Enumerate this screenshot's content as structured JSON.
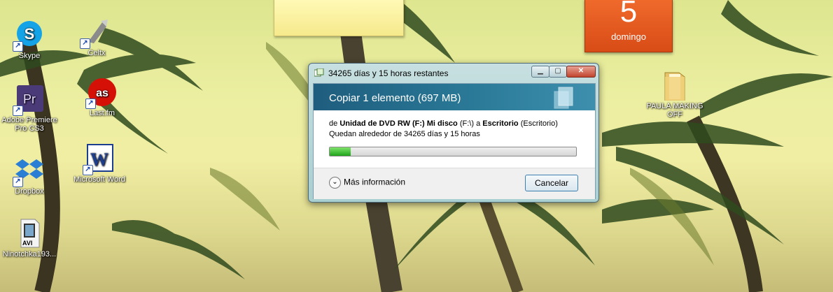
{
  "desktop_icons": [
    {
      "label": "Skype",
      "icon": "skype-icon"
    },
    {
      "label": "Celtx",
      "icon": "celtx-icon"
    },
    {
      "label": "Adobe Premiere Pro CS3",
      "icon": "premiere-icon"
    },
    {
      "label": "Last.fm",
      "icon": "lastfm-icon"
    },
    {
      "label": "Dropbox",
      "icon": "dropbox-icon"
    },
    {
      "label": "Microsoft Word",
      "icon": "word-icon"
    },
    {
      "label": "Ninotchka193...",
      "icon": "avi-file-icon",
      "badge": "AVI"
    },
    {
      "label": "PAULA MAKING OFF",
      "icon": "folder-icon"
    }
  ],
  "calendar": {
    "day": "5",
    "weekday": "domingo"
  },
  "dialog": {
    "title": "34265 días y 15 horas restantes",
    "header": "Copiar 1 elemento (697 MB)",
    "from_prefix": "de",
    "source": "Unidad de DVD RW (F:) Mi disco",
    "source_path": "(F:\\)",
    "to_word": "a",
    "destination": "Escritorio",
    "destination_paren": "(Escritorio)",
    "remaining": "Quedan alrededor de 34265 días y 15 horas",
    "progress": 0.085,
    "more_info": "Más información",
    "cancel": "Cancelar",
    "progress_color": "#2fb52a"
  },
  "colors": {
    "calendar_bg": "#e25a1f",
    "header_band": "#2b7b99"
  }
}
